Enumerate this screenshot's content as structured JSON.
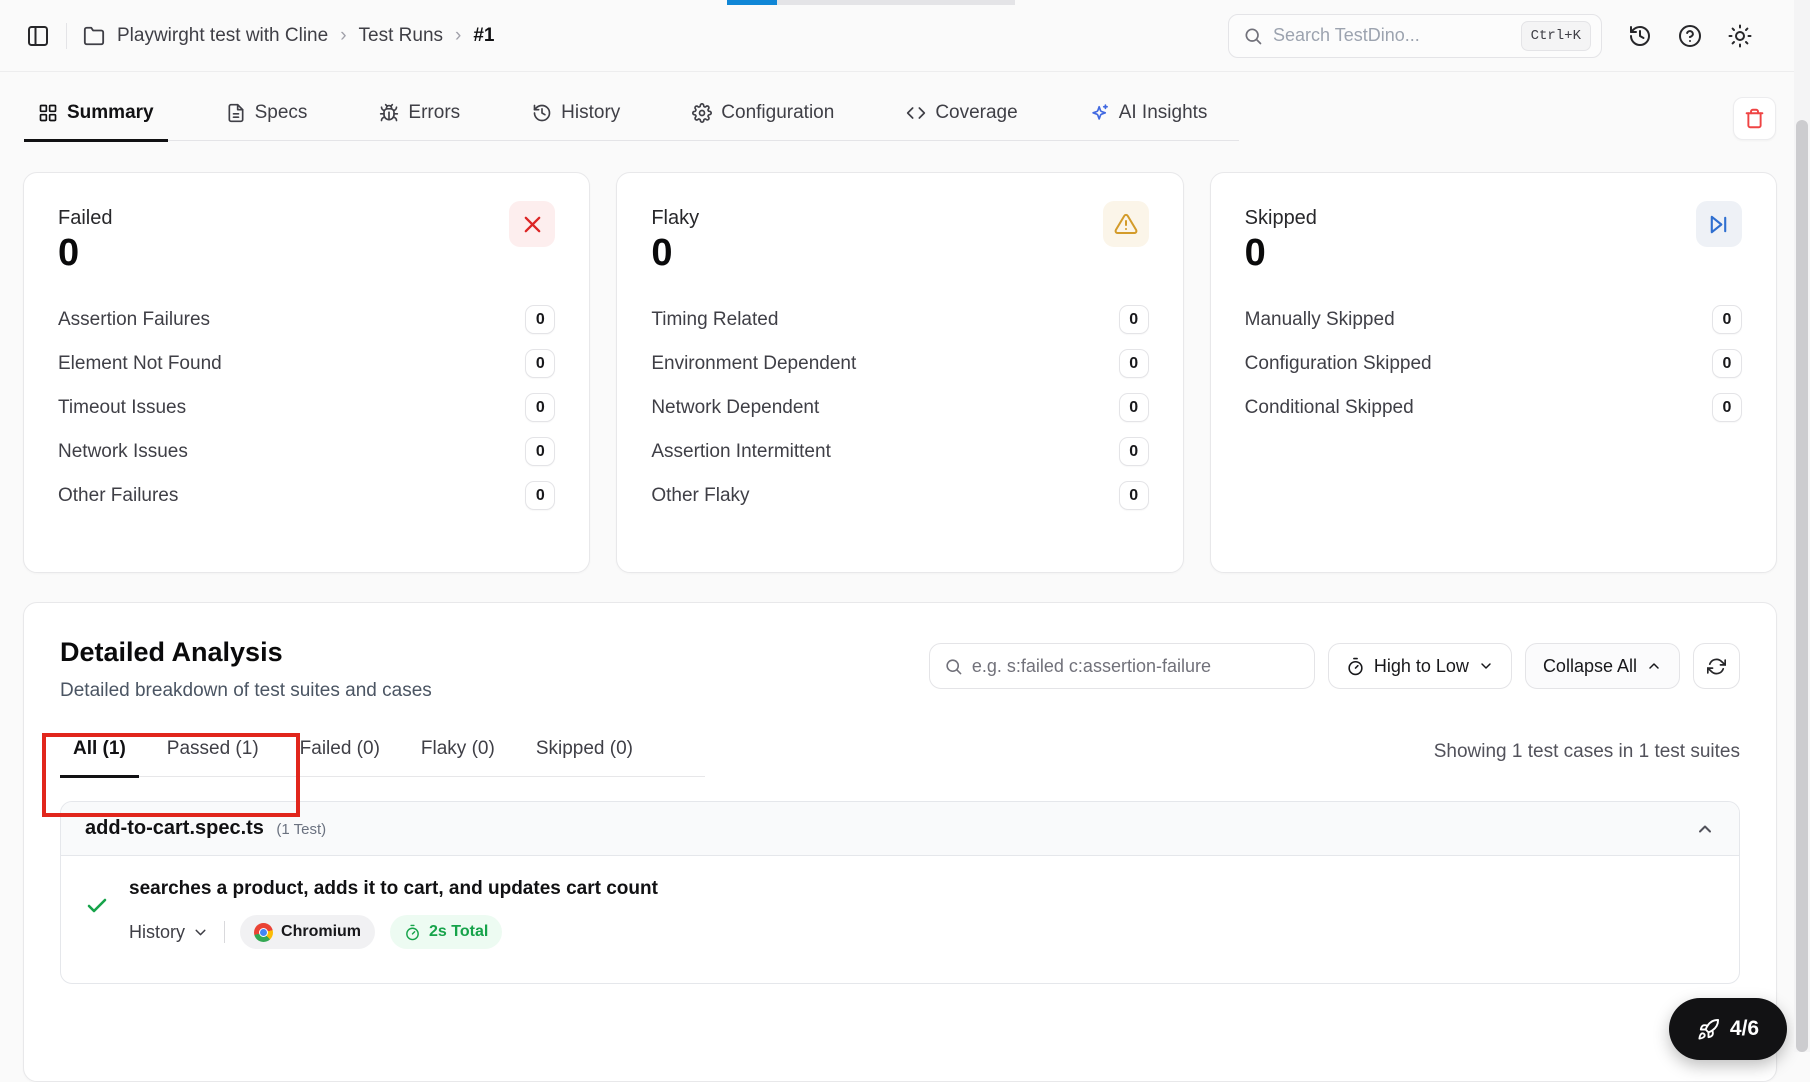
{
  "header": {
    "breadcrumb": {
      "project": "Playwirght test with Cline",
      "section": "Test Runs",
      "run": "#1"
    },
    "search": {
      "placeholder": "Search TestDino...",
      "shortcut": "Ctrl+K"
    }
  },
  "main_tabs": [
    {
      "label": "Summary",
      "active": true
    },
    {
      "label": "Specs"
    },
    {
      "label": "Errors"
    },
    {
      "label": "History"
    },
    {
      "label": "Configuration"
    },
    {
      "label": "Coverage"
    },
    {
      "label": "AI Insights"
    }
  ],
  "cards": [
    {
      "title": "Failed",
      "count": "0",
      "rows": [
        {
          "label": "Assertion Failures",
          "value": "0"
        },
        {
          "label": "Element Not Found",
          "value": "0"
        },
        {
          "label": "Timeout Issues",
          "value": "0"
        },
        {
          "label": "Network Issues",
          "value": "0"
        },
        {
          "label": "Other Failures",
          "value": "0"
        }
      ]
    },
    {
      "title": "Flaky",
      "count": "0",
      "rows": [
        {
          "label": "Timing Related",
          "value": "0"
        },
        {
          "label": "Environment Dependent",
          "value": "0"
        },
        {
          "label": "Network Dependent",
          "value": "0"
        },
        {
          "label": "Assertion Intermittent",
          "value": "0"
        },
        {
          "label": "Other Flaky",
          "value": "0"
        }
      ]
    },
    {
      "title": "Skipped",
      "count": "0",
      "rows": [
        {
          "label": "Manually Skipped",
          "value": "0"
        },
        {
          "label": "Configuration Skipped",
          "value": "0"
        },
        {
          "label": "Conditional Skipped",
          "value": "0"
        }
      ]
    }
  ],
  "analysis": {
    "title": "Detailed Analysis",
    "subtitle": "Detailed breakdown of test suites and cases",
    "search_placeholder": "e.g. s:failed c:assertion-failure",
    "sort_label": "High to Low",
    "collapse_label": "Collapse All",
    "filter_tabs": [
      {
        "label": "All (1)",
        "active": true
      },
      {
        "label": "Passed (1)"
      },
      {
        "label": "Failed (0)"
      },
      {
        "label": "Flaky (0)"
      },
      {
        "label": "Skipped (0)"
      }
    ],
    "showing_text": "Showing 1 test cases in 1 test suites",
    "suite": {
      "name": "add-to-cart.spec.ts",
      "count_label": "(1 Test)",
      "test": {
        "title": "searches a product, adds it to cart, and updates cart count",
        "history_label": "History",
        "browser": "Chromium",
        "duration": "2s Total"
      }
    }
  },
  "fab": {
    "label": "4/6"
  },
  "icons": {
    "failed_card": "x-icon",
    "flaky_card": "warning-triangle-icon",
    "skipped_card": "skip-forward-icon",
    "fab": "rocket-icon"
  },
  "colors": {
    "accent_blue": "#1086d6",
    "annotation_red": "#e1261c",
    "failed_red": "#dc2626",
    "flaky_amber": "#d39b2a",
    "skipped_blue": "#2f6fd0",
    "passed_green": "#16a34a",
    "ai_blue": "#4169e1"
  }
}
